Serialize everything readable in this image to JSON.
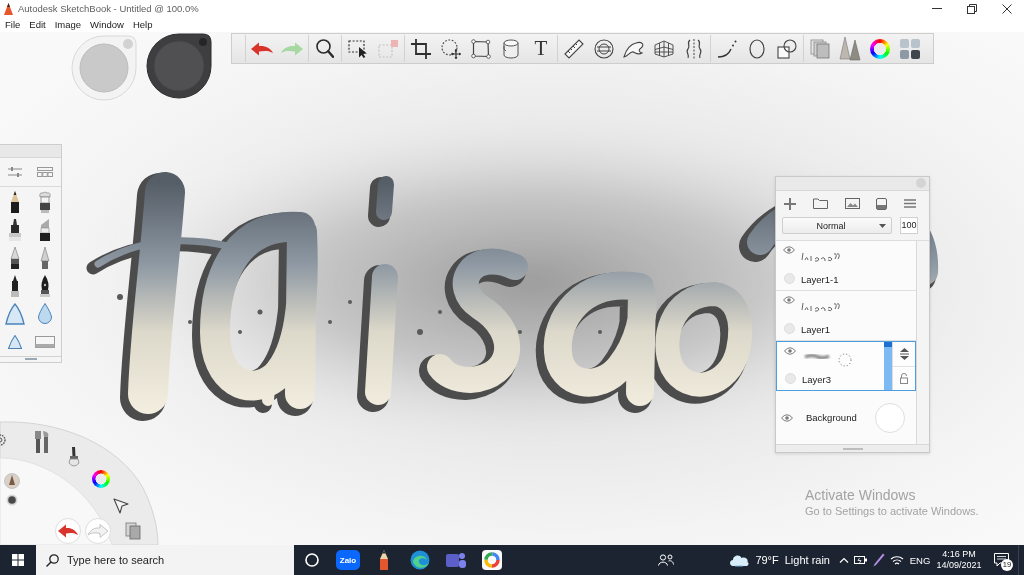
{
  "window": {
    "title": "Autodesk SketchBook - Untitled @ 100.0%"
  },
  "menu": [
    "File",
    "Edit",
    "Image",
    "Window",
    "Help"
  ],
  "toolbar": {
    "undo": {
      "disabled": false
    },
    "redo": {
      "disabled": true
    },
    "text_tool": "T"
  },
  "layers_panel": {
    "blend_mode": "Normal",
    "opacity": "100",
    "layers": [
      {
        "name": "Layer1-1",
        "kind": "layer",
        "visible": true,
        "selected": false
      },
      {
        "name": "Layer1",
        "kind": "layer",
        "visible": true,
        "selected": false
      },
      {
        "name": "Layer3",
        "kind": "layer",
        "visible": true,
        "selected": true,
        "level": 1
      },
      {
        "name": "Background",
        "kind": "background",
        "visible": true,
        "selected": false
      }
    ]
  },
  "lagoon": {
    "undo": {
      "disabled": false
    },
    "redo": {
      "disabled": true
    }
  },
  "activation_notice": {
    "title": "Activate Windows",
    "message": "Go to Settings to activate Windows."
  },
  "taskbar": {
    "search": {
      "placeholder": "Type here to search"
    },
    "app_logo_text": "Zalo",
    "weather": {
      "temperature": "79°F",
      "condition": "Light rain"
    },
    "language": "ENG",
    "time": "4:16 PM",
    "date": "14/09/2021",
    "notification_count": "19"
  }
}
